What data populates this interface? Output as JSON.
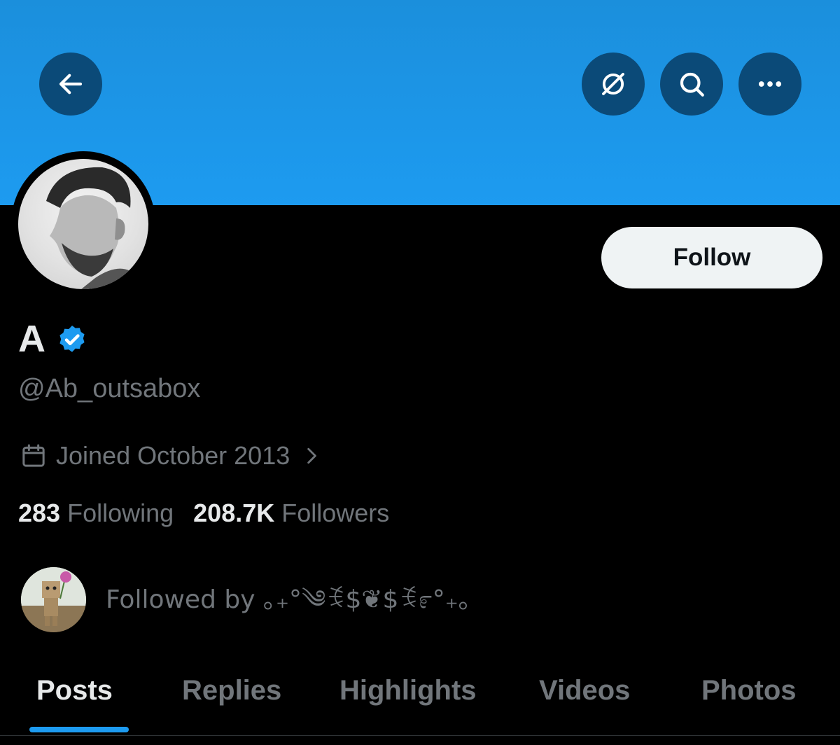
{
  "banner": {
    "color": "#1d9bf0"
  },
  "header_buttons": {
    "back_icon": "arrow-left-icon",
    "grok_icon": "grok-icon",
    "search_icon": "search-icon",
    "more_icon": "more-horizontal-icon"
  },
  "profile": {
    "display_name": "A",
    "verified": true,
    "handle": "@Ab_outsabox",
    "joined": "Joined October 2013",
    "following_count": "283",
    "following_label": "Following",
    "followers_count": "208.7K",
    "followers_label": "Followers",
    "followed_by": "Followed by ｡₊°༄ꉂ$❦$ꉂ೯°₊｡"
  },
  "follow_button": {
    "label": "Follow"
  },
  "tabs": [
    {
      "label": "Posts",
      "active": true
    },
    {
      "label": "Replies",
      "active": false
    },
    {
      "label": "Highlights",
      "active": false
    },
    {
      "label": "Videos",
      "active": false
    },
    {
      "label": "Photos",
      "active": false
    }
  ],
  "colors": {
    "accent": "#1d9bf0",
    "background": "#000000",
    "secondary_text": "#71767b",
    "primary_text": "#e7e9ea"
  }
}
